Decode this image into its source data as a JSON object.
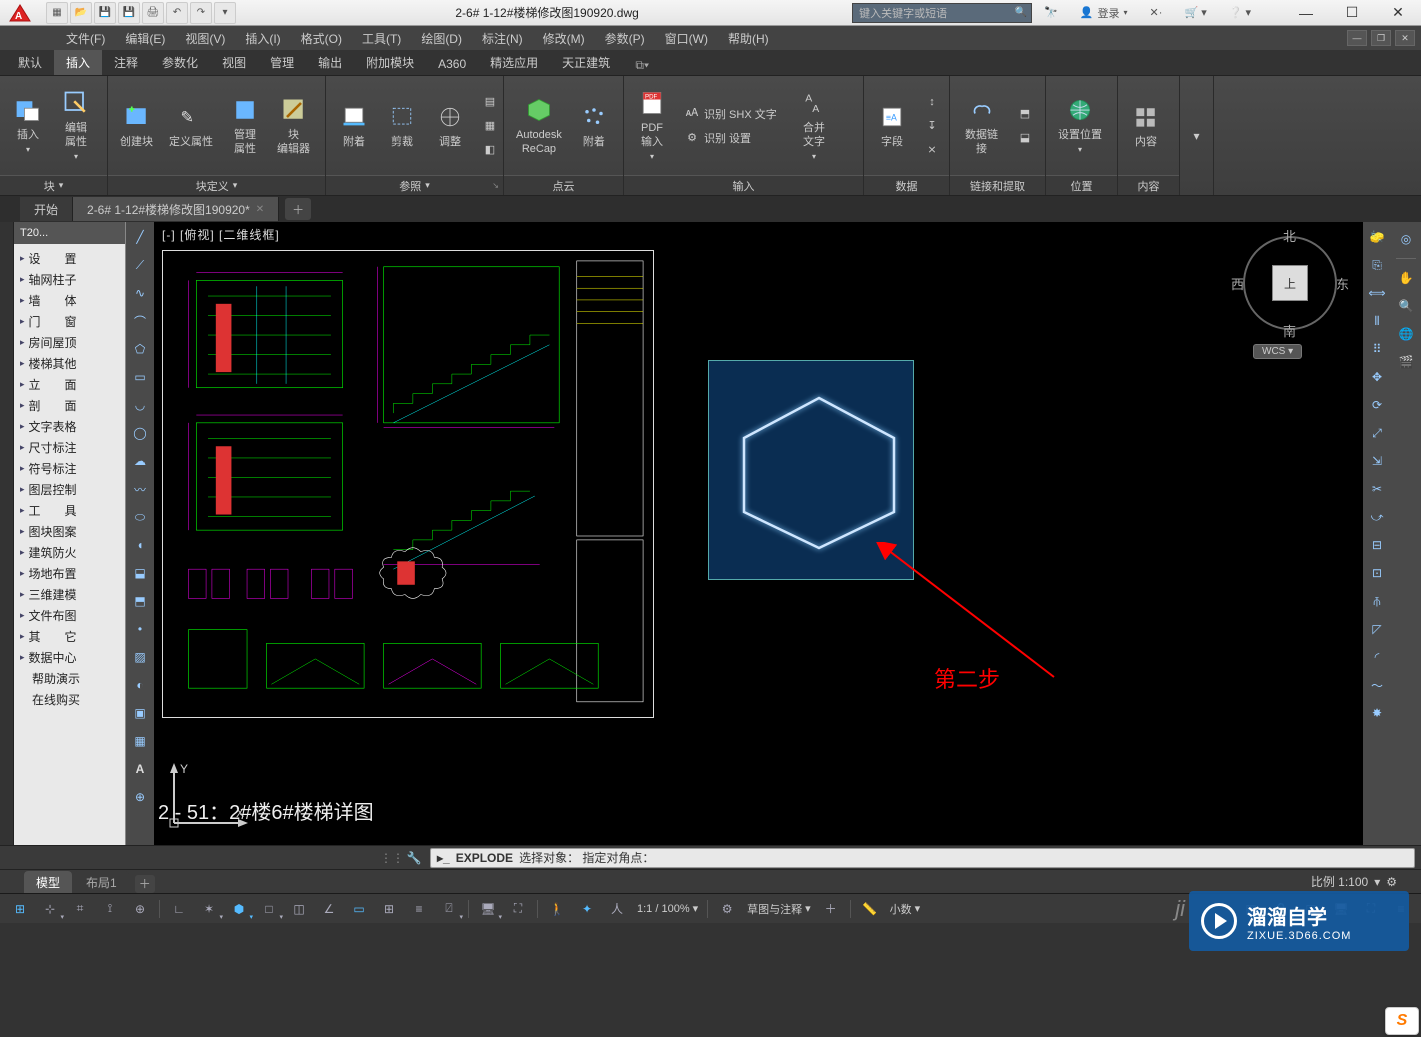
{
  "titlebar": {
    "doc_title": "2-6# 1-12#楼梯修改图190920.dwg",
    "search_placeholder": "键入关键字或短语",
    "sign_in": "登录"
  },
  "menubar": {
    "items": [
      "文件(F)",
      "编辑(E)",
      "视图(V)",
      "插入(I)",
      "格式(O)",
      "工具(T)",
      "绘图(D)",
      "标注(N)",
      "修改(M)",
      "参数(P)",
      "窗口(W)",
      "帮助(H)"
    ]
  },
  "ribbon_tabs": {
    "items": [
      "默认",
      "插入",
      "注释",
      "参数化",
      "视图",
      "管理",
      "输出",
      "附加模块",
      "A360",
      "精选应用",
      "天正建筑"
    ],
    "active_index": 1
  },
  "ribbon": {
    "panels": [
      {
        "name": "块",
        "footer": "块",
        "footer_arrow": true,
        "buttons": [
          {
            "label": "插入",
            "arrow": true,
            "icon": "insert-block"
          },
          {
            "label": "编辑\n属性",
            "arrow": true,
            "icon": "edit-attr"
          }
        ]
      },
      {
        "name": "块定义",
        "footer": "块定义",
        "footer_arrow": true,
        "buttons": [
          {
            "label": "创建块",
            "icon": "create-block"
          },
          {
            "label": "定义属性",
            "icon": "define-attr"
          },
          {
            "label": "管理\n属性",
            "icon": "manage-attr"
          },
          {
            "label": "块\n编辑器",
            "icon": "block-editor"
          }
        ]
      },
      {
        "name": "参照",
        "footer": "参照",
        "footer_arrow": true,
        "corner": true,
        "buttons": [
          {
            "label": "附着",
            "icon": "attach"
          },
          {
            "label": "剪裁",
            "icon": "clip"
          },
          {
            "label": "调整",
            "icon": "adjust"
          }
        ],
        "side_btns": [
          "a",
          "b",
          "c"
        ]
      },
      {
        "name": "点云",
        "footer": "点云",
        "buttons": [
          {
            "label": "Autodesk\nReCap",
            "icon": "recap"
          },
          {
            "label": "附着",
            "icon": "attach-pc"
          }
        ]
      },
      {
        "name": "输入",
        "footer": "输入",
        "buttons_pdf": {
          "label": "PDF\n输入",
          "arrow": true,
          "icon": "pdf"
        },
        "small": [
          {
            "label": "识别 SHX 文字",
            "icon": "shx"
          },
          {
            "label": "识别 设置",
            "icon": "shx-settings"
          }
        ],
        "merge": {
          "label": "合并\n文字",
          "arrow": true,
          "icon": "merge-text"
        }
      },
      {
        "name": "数据",
        "footer": "数据",
        "buttons": [
          {
            "label": "字段",
            "icon": "field"
          }
        ],
        "side_btns": [
          "u",
          "d",
          "x"
        ]
      },
      {
        "name": "链接和提取",
        "footer": "链接和提取",
        "buttons": [
          {
            "label": "数据链接",
            "icon": "datalink"
          }
        ],
        "side_btns": [
          "e",
          "f"
        ]
      },
      {
        "name": "位置",
        "footer": "位置",
        "buttons": [
          {
            "label": "设置位置",
            "arrow": true,
            "icon": "globe"
          }
        ]
      },
      {
        "name": "内容",
        "footer": "内容",
        "buttons": [
          {
            "label": "内容",
            "icon": "content"
          }
        ]
      }
    ]
  },
  "doc_tabs": {
    "items": [
      {
        "label": "开始",
        "active": false
      },
      {
        "label": "2-6# 1-12#楼梯修改图190920*",
        "active": true
      }
    ]
  },
  "left_palette": {
    "title": "T20...",
    "items": [
      "设　　置",
      "轴网柱子",
      "墙　　体",
      "门　　窗",
      "房间屋顶",
      "楼梯其他",
      "立　　面",
      "剖　　面",
      "文字表格",
      "尺寸标注",
      "符号标注",
      "图层控制",
      "工　　具",
      "图块图案",
      "建筑防火",
      "场地布置",
      "三维建模",
      "文件布图",
      "其　　它",
      "数据中心",
      "帮助演示",
      "在线购买"
    ]
  },
  "viewport": {
    "label_parts": [
      "[-]",
      "[俯视]",
      "[二维线框]"
    ],
    "viewcube": {
      "n": "北",
      "s": "南",
      "e": "东",
      "w": "西",
      "face": "上",
      "wcs": "WCS ▾"
    }
  },
  "annotation": {
    "step_text": "第二步"
  },
  "drawing_title": "2 - 51：2#楼6#楼梯详图",
  "cmdline": {
    "prompt": "▸",
    "command": "EXPLODE",
    "text": "选择对象：  指定对角点："
  },
  "layout_tabs": {
    "items": [
      "模型",
      "布局1"
    ],
    "active_index": 0,
    "scale_label": "比例 1:100"
  },
  "statusbar": {
    "coord_group": [
      "grid",
      "snap",
      "infer",
      "dyn"
    ],
    "mid_text_1": "1:1 / 100%",
    "anno_label": "草图与注释",
    "scale_label": "小数"
  },
  "brand": {
    "title": "溜溜自学",
    "sub": "ZIXUE.3D66.COM"
  },
  "ji": "ji"
}
